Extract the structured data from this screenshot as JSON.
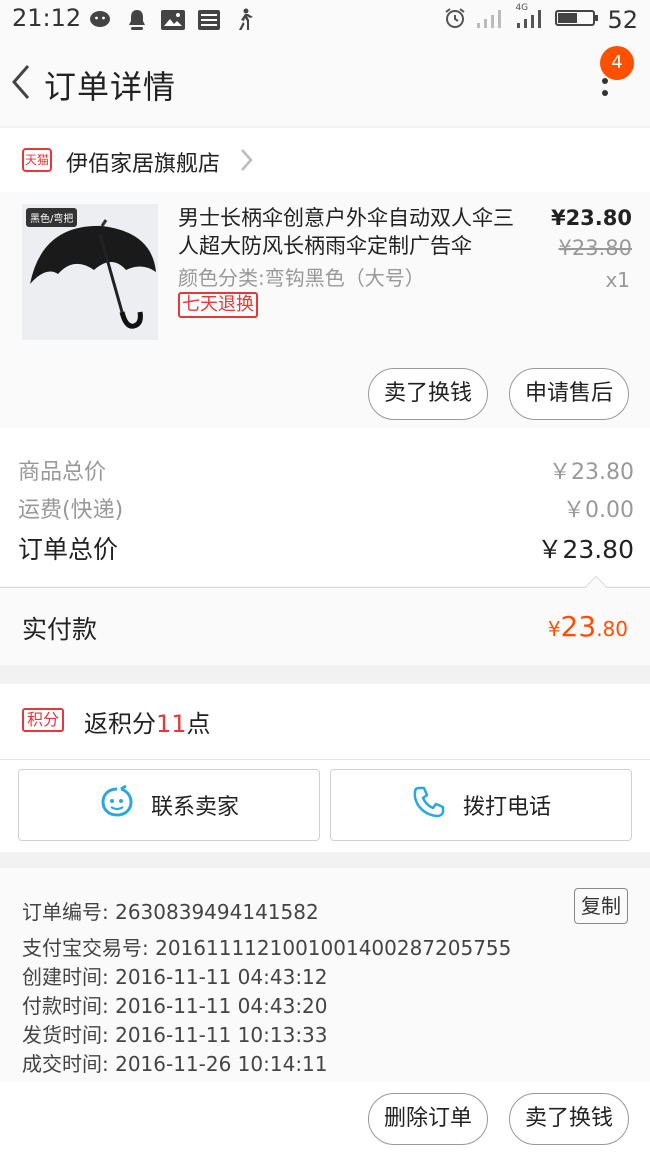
{
  "status_bar": {
    "time": "21:12",
    "network": "4G",
    "battery": "52"
  },
  "nav": {
    "title": "订单详情",
    "badge_count": "4"
  },
  "shop": {
    "badge": "天猫",
    "name": "伊佰家居旗舰店"
  },
  "item": {
    "image_tag": "黑色/弯把",
    "title": "男士长柄伞创意户外伞自动双人伞三人超大防风长柄雨伞定制广告伞",
    "sku": "颜色分类:弯钩黑色（大号）",
    "service_tag": "七天退换",
    "price": "¥23.80",
    "original_price": "¥23.80",
    "quantity": "x1",
    "sell_button": "卖了换钱",
    "aftersale_button": "申请售后"
  },
  "summary": {
    "goods_label": "商品总价",
    "goods_value": "￥23.80",
    "shipping_label": "运费(快递)",
    "shipping_value": "￥0.00",
    "total_label": "订单总价",
    "total_value": "￥23.80"
  },
  "paid": {
    "label": "实付款",
    "currency": "¥",
    "integer": "23",
    "decimal": ".80"
  },
  "points": {
    "tag": "积分",
    "prefix": "返积分",
    "number": "11",
    "suffix": "点"
  },
  "contact": {
    "seller_label": "联系卖家",
    "phone_label": "拨打电话"
  },
  "order_info": {
    "order_no": "订单编号: 2630839494141582",
    "copy_label": "复制",
    "alipay_no": "支付宝交易号: 2016111121001001400287205755",
    "created": "创建时间: 2016-11-11 04:43:12",
    "paid": "付款时间: 2016-11-11 04:43:20",
    "shipped": "发货时间: 2016-11-11 10:13:33",
    "completed": "成交时间: 2016-11-26 10:14:11"
  },
  "bottom_actions": {
    "delete_label": "删除订单",
    "sell_label": "卖了换钱"
  },
  "colors": {
    "accent_orange": "#ff5000",
    "tmall_red": "#e4393c",
    "contact_blue": "#29a8e0"
  },
  "icons": [
    "wechat-icon",
    "qq-icon",
    "gallery-icon",
    "news-icon",
    "walk-icon",
    "alarm-icon",
    "signal-icon",
    "battery-icon",
    "back-arrow-icon",
    "more-vertical-icon",
    "chevron-right-icon",
    "wangwang-chat-icon",
    "phone-icon"
  ]
}
